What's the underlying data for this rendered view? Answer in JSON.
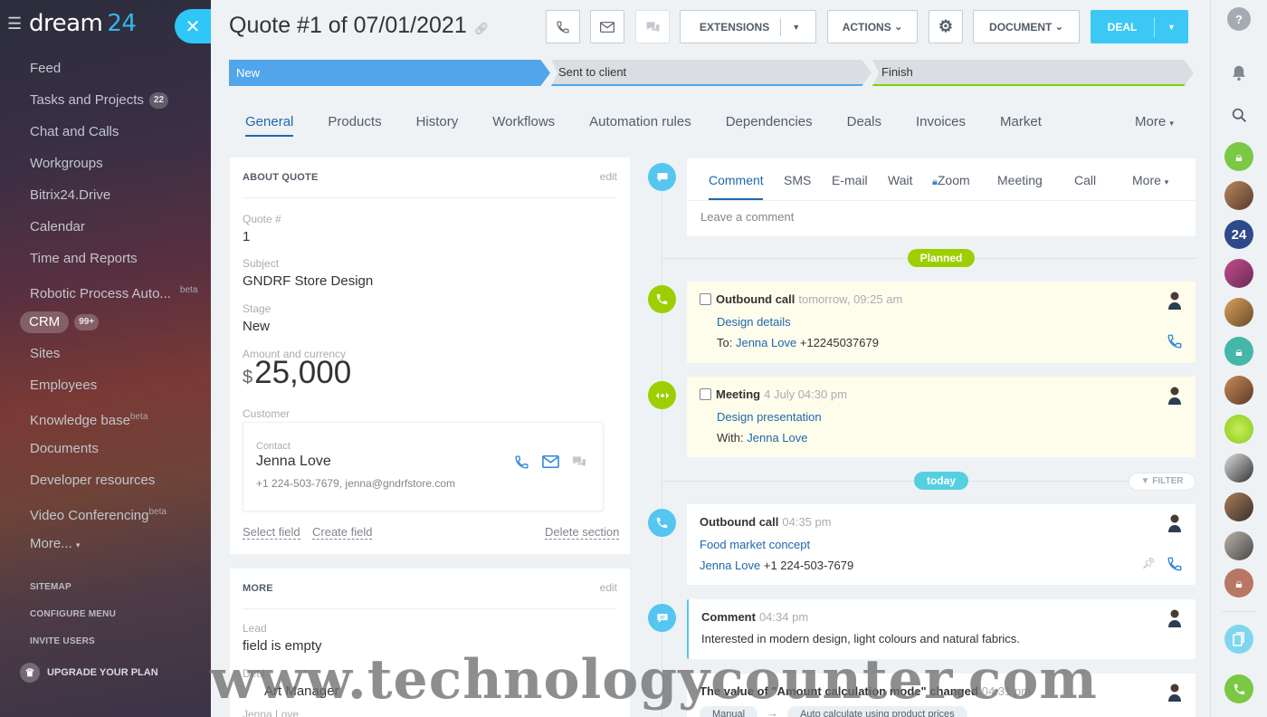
{
  "sidebar": {
    "logo_main": "dream",
    "logo_num": "24",
    "items": [
      {
        "label": "Feed"
      },
      {
        "label": "Tasks and Projects",
        "count": "22"
      },
      {
        "label": "Chat and Calls"
      },
      {
        "label": "Workgroups"
      },
      {
        "label": "Bitrix24.Drive"
      },
      {
        "label": "Calendar"
      },
      {
        "label": "Time and Reports"
      },
      {
        "label": "Robotic Process Auto...",
        "beta": "beta"
      },
      {
        "label": "CRM",
        "count": "99+"
      },
      {
        "label": "Sites"
      },
      {
        "label": "Employees"
      },
      {
        "label": "Knowledge base",
        "beta": "beta"
      },
      {
        "label": "Documents"
      },
      {
        "label": "Developer resources"
      },
      {
        "label": "Video Conferencing",
        "beta": "beta"
      },
      {
        "label": "More..."
      }
    ],
    "sitemap": "SITEMAP",
    "configure_menu": "CONFIGURE MENU",
    "invite_users": "INVITE USERS",
    "upgrade": "UPGRADE YOUR PLAN"
  },
  "header": {
    "title": "Quote #1 of 07/01/2021",
    "extensions": "EXTENSIONS",
    "actions": "ACTIONS",
    "document": "DOCUMENT",
    "deal": "DEAL"
  },
  "stages": {
    "new": "New",
    "sent": "Sent to client",
    "finish": "Finish"
  },
  "tabs": [
    "General",
    "Products",
    "History",
    "Workflows",
    "Automation rules",
    "Dependencies",
    "Deals",
    "Invoices",
    "Market"
  ],
  "tabs_more": "More",
  "about": {
    "header": "ABOUT QUOTE",
    "edit": "edit",
    "quote_label": "Quote #",
    "quote_value": "1",
    "subject_label": "Subject",
    "subject_value": "GNDRF Store Design",
    "stage_label": "Stage",
    "stage_value": "New",
    "amount_label": "Amount and currency",
    "currency": "$",
    "amount": "25,000",
    "customer_label": "Customer",
    "contact_label": "Contact",
    "contact_name": "Jenna Love",
    "contact_details": "+1 224-503-7679, jenna@gndrfstore.com",
    "select_field": "Select field",
    "create_field": "Create field",
    "delete_section": "Delete section"
  },
  "more_card": {
    "header": "MORE",
    "edit": "edit",
    "lead_label": "Lead",
    "lead_value": "field is empty",
    "deal_label": "Deal",
    "deal_value": "Art Manager",
    "contact_value": "Jenna Love"
  },
  "composer": {
    "tabs": [
      "Comment",
      "SMS",
      "E-mail",
      "Wait",
      "Zoom",
      "Meeting",
      "Call"
    ],
    "more": "More",
    "placeholder": "Leave a comment"
  },
  "timeline": {
    "planned": "Planned",
    "today": "today",
    "filter": "FILTER",
    "events": [
      {
        "type": "Outbound call",
        "time": "tomorrow, 09:25 am",
        "link": "Design details",
        "to_label": "To:",
        "person": "Jenna Love",
        "phone": "+12245037679"
      },
      {
        "type": "Meeting",
        "time": "4 July 04:30 pm",
        "link": "Design presentation",
        "with_label": "With:",
        "person": "Jenna Love"
      },
      {
        "type": "Outbound call",
        "time": "04:35 pm",
        "link": "Food market concept",
        "person": "Jenna Love",
        "phone": "+1 224-503-7679"
      },
      {
        "type": "Comment",
        "time": "04:34 pm",
        "text": "Interested in modern design, light colours and natural fabrics."
      },
      {
        "type": "The value of \"Amount calculation mode\" changed",
        "time": "04:31 pm",
        "from": "Manual",
        "to": "Auto calculate using product prices"
      }
    ]
  },
  "rightbar": {
    "icons": [
      "help-icon",
      "bell-icon",
      "search-icon",
      "lock-icon",
      "avatar",
      "b24-icon",
      "avatar",
      "avatar",
      "lock-icon",
      "avatar",
      "avatar",
      "avatar",
      "avatar",
      "avatar",
      "lock-icon",
      "copy-icon",
      "phone-icon"
    ],
    "b24_label": "24"
  },
  "colors": {
    "accent": "#2fc7f7",
    "stage_new": "#50a5eb",
    "stage_finish_line": "#7bd500",
    "link": "#2067b0",
    "planned": "#9dcf00",
    "today": "#55d0e0"
  },
  "watermark": "www.technologycounter.com"
}
